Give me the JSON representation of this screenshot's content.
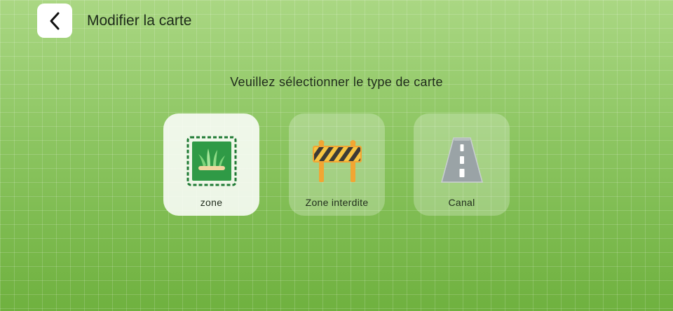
{
  "header": {
    "back_icon": "chevron-left-icon",
    "title": "Modifier la carte"
  },
  "prompt": "Veuillez sélectionner le type de carte",
  "map_types": [
    {
      "label": "zone",
      "icon": "grass-zone-icon",
      "selected": true
    },
    {
      "label": "Zone interdite",
      "icon": "barrier-icon",
      "selected": false
    },
    {
      "label": "Canal",
      "icon": "road-icon",
      "selected": false
    }
  ],
  "colors": {
    "background": "#8cc460",
    "zone_green": "#2f9a46",
    "barrier_orange": "#f2a633",
    "road_gray": "#9aa3a6"
  }
}
